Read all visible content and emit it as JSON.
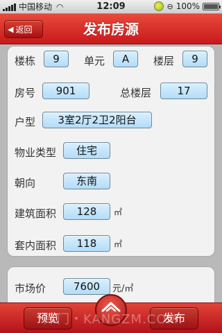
{
  "status_bar": {
    "carrier": "中国移动",
    "time": "12:09",
    "battery": "100%",
    "battery_level": 1.0
  },
  "nav": {
    "back_label": "返回",
    "title": "发布房源"
  },
  "form": {
    "building_label": "楼栋",
    "building_value": "9",
    "unit_label": "单元",
    "unit_value": "A",
    "floor_label": "楼层",
    "floor_value": "9",
    "room_label": "房号",
    "room_value": "901",
    "total_floors_label": "总楼层",
    "total_floors_value": "17",
    "layout_label": "户型",
    "layout_value": "3室2厅2卫2阳台",
    "property_type_label": "物业类型",
    "property_type_value": "住宅",
    "orientation_label": "朝向",
    "orientation_value": "东南",
    "build_area_label": "建筑面积",
    "build_area_value": "128",
    "build_area_unit": "㎡",
    "inner_area_label": "套内面积",
    "inner_area_value": "118",
    "inner_area_unit": "㎡",
    "price_label": "市场价",
    "price_value": "7600",
    "price_unit": "元/㎡"
  },
  "bottom": {
    "preview_label": "预览",
    "publish_label": "发布",
    "watermark": "库门・KANGZM.COM"
  }
}
